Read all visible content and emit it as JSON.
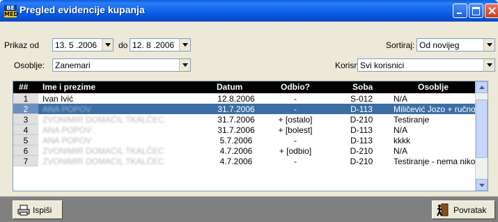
{
  "window": {
    "title": "Pregled evidencije kupanja",
    "icon_top": "BE",
    "icon_bottom": "MED"
  },
  "filters": {
    "prikaz_od_label": "Prikaz od",
    "date_from": "13. 5 .2006",
    "do_label": "do",
    "date_to": "12. 8 .2006",
    "sortiraj_label": "Sortiraj:",
    "sortiraj_value": "Od novijeg",
    "osoblje_label": "Osoblje:",
    "osoblje_value": "Zanemari",
    "korisnik_label": "Korisnik:",
    "korisnik_value": "Svi korisnici"
  },
  "table": {
    "headers": {
      "num": "##",
      "name": "Ime i prezime",
      "datum": "Datum",
      "odbio": "Odbio?",
      "soba": "Soba",
      "osoblje": "Osoblje"
    },
    "rows": [
      {
        "num": "1",
        "name": "Ivan Ivić",
        "datum": "12.8.2006",
        "odbio": "-",
        "soba": "S-012",
        "osoblje": "N/A"
      },
      {
        "num": "2",
        "name": "ANA POPOV",
        "datum": "31.7.2006",
        "odbio": "-",
        "soba": "D-113",
        "osoblje": "Miličević Jozo + ručno doz"
      },
      {
        "num": "3",
        "name": "ZVONIMIR DOMAĆIL TKALČEC",
        "datum": "31.7.2006",
        "odbio": "+ [ostalo]",
        "soba": "D-210",
        "osoblje": "Testiranje"
      },
      {
        "num": "4",
        "name": "ANA POPOV",
        "datum": "31.7.2006",
        "odbio": "+ [bolest]",
        "soba": "D-113",
        "osoblje": "N/A"
      },
      {
        "num": "5",
        "name": "ANA POPOV",
        "datum": "5.7.2006",
        "odbio": "-",
        "soba": "D-113",
        "osoblje": "kkkk"
      },
      {
        "num": "6",
        "name": "ZVONIMIR DOMAĆIL TKALČEC",
        "datum": "4.7.2006",
        "odbio": "+ [odbio]",
        "soba": "D-210",
        "osoblje": "N/A"
      },
      {
        "num": "7",
        "name": "ZVONIMIR DOMAĆIL TKALČEC",
        "datum": "4.7.2006",
        "odbio": "-",
        "soba": "D-210",
        "osoblje": "Testiranje - nema nikog z"
      }
    ]
  },
  "buttons": {
    "print": "Ispiši",
    "back": "Povratak"
  },
  "colors": {
    "titlebar": "#0a5de8",
    "selection": "#3a6ea5",
    "window_bg": "#ece9d8"
  },
  "icons": {
    "print": "printer-icon",
    "back": "exit-door-icon"
  }
}
